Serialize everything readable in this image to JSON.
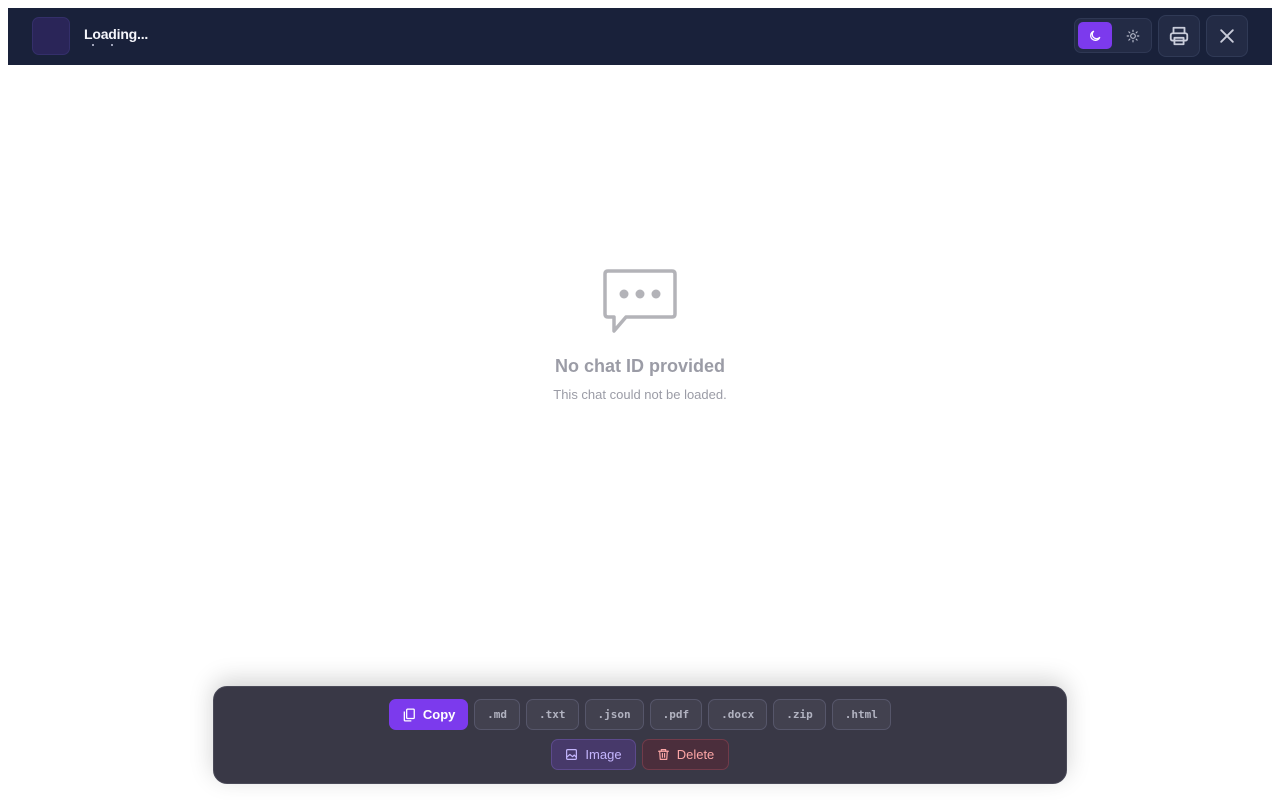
{
  "header": {
    "title": "Loading...",
    "theme": {
      "dark_icon": "moon-icon",
      "light_icon": "sun-icon",
      "active": "dark",
      "active_color": "#7c3aed"
    },
    "print_icon": "printer-icon",
    "close_icon": "close-icon",
    "background": "#19213a"
  },
  "empty_state": {
    "icon": "chat-bubble-icon",
    "title": "No chat ID provided",
    "subtitle": "This chat could not be loaded."
  },
  "toolbar": {
    "copy_label": "Copy",
    "copy_icon": "copy-icon",
    "formats": [
      ".md",
      ".txt",
      ".json",
      ".pdf",
      ".docx",
      ".zip",
      ".html"
    ],
    "image_label": "Image",
    "image_icon": "image-icon",
    "delete_label": "Delete",
    "delete_icon": "trash-icon",
    "accent_color": "#7c3aed",
    "danger_color": "#fca5a5"
  }
}
